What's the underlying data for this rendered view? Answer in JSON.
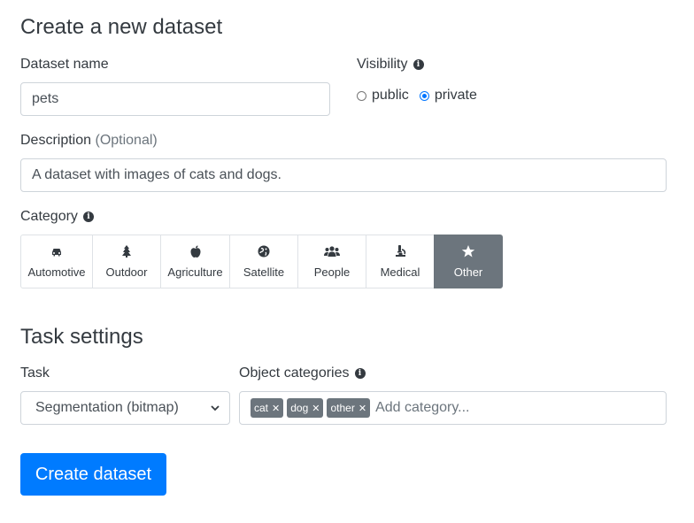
{
  "page_title": "Create a new dataset",
  "dataset_name": {
    "label": "Dataset name",
    "value": "pets"
  },
  "visibility": {
    "label": "Visibility",
    "options": [
      {
        "label": "public",
        "checked": false
      },
      {
        "label": "private",
        "checked": true
      }
    ]
  },
  "description": {
    "label": "Description",
    "optional": "(Optional)",
    "value": "A dataset with images of cats and dogs."
  },
  "category": {
    "label": "Category",
    "items": [
      {
        "label": "Automotive",
        "icon": "car-icon"
      },
      {
        "label": "Outdoor",
        "icon": "tree-icon"
      },
      {
        "label": "Agriculture",
        "icon": "apple-icon"
      },
      {
        "label": "Satellite",
        "icon": "globe-icon"
      },
      {
        "label": "People",
        "icon": "users-icon"
      },
      {
        "label": "Medical",
        "icon": "microscope-icon"
      },
      {
        "label": "Other",
        "icon": "star-icon",
        "selected": true
      }
    ]
  },
  "task_settings": {
    "title": "Task settings",
    "task": {
      "label": "Task",
      "value": "Segmentation (bitmap)"
    },
    "object_categories": {
      "label": "Object categories",
      "tags": [
        "cat",
        "dog",
        "other"
      ],
      "placeholder": "Add category..."
    }
  },
  "submit_label": "Create dataset",
  "colors": {
    "primary": "#007bff",
    "active": "#6c757d",
    "text": "#343a40"
  }
}
